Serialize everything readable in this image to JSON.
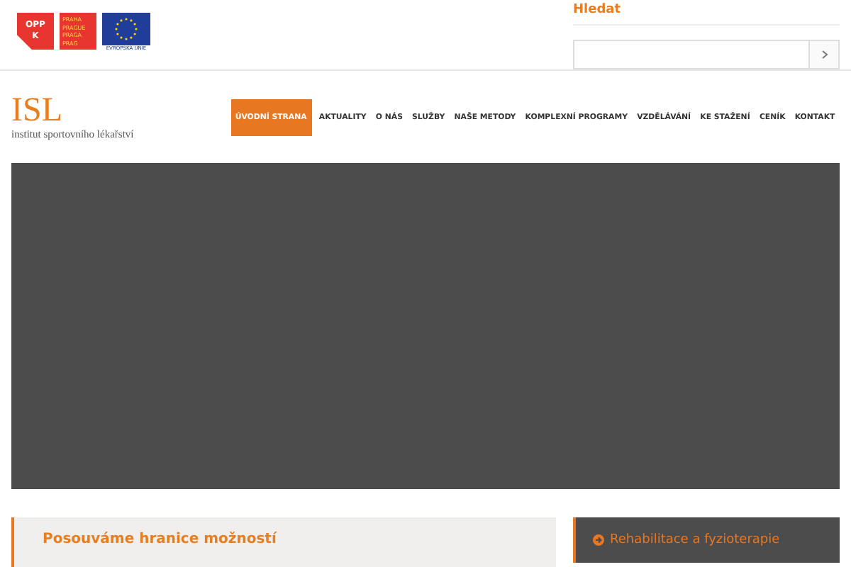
{
  "top_logos": {
    "oppk": [
      "OPP",
      "K"
    ],
    "praha": [
      "PRAHA",
      "PRAGUE",
      "PRAGA",
      "PRAG"
    ],
    "eu": "EVROPSKÁ UNIE"
  },
  "search": {
    "title": "Hledat"
  },
  "logo": {
    "mark": "ISL",
    "tagline": "institut sportovního lékařství"
  },
  "nav": [
    {
      "label": "ÚVODNÍ STRANA",
      "selected": true
    },
    {
      "label": "AKTUALITY",
      "selected": false
    },
    {
      "label": "O NÁS",
      "selected": false
    },
    {
      "label": "SLUŽBY",
      "selected": false
    },
    {
      "label": "NAŠE METODY",
      "selected": false
    },
    {
      "label": "KOMPLEXNÍ PROGRAMY",
      "selected": false
    },
    {
      "label": "VZDĚLÁVÁNÍ",
      "selected": false
    },
    {
      "label": "KE STAŽENÍ",
      "selected": false
    },
    {
      "label": "CENÍK",
      "selected": false
    },
    {
      "label": "KONTAKT",
      "selected": false
    }
  ],
  "intro": {
    "title": "Posouváme hranice možností"
  },
  "side_link": "Rehabilitace a fyzioterapie"
}
